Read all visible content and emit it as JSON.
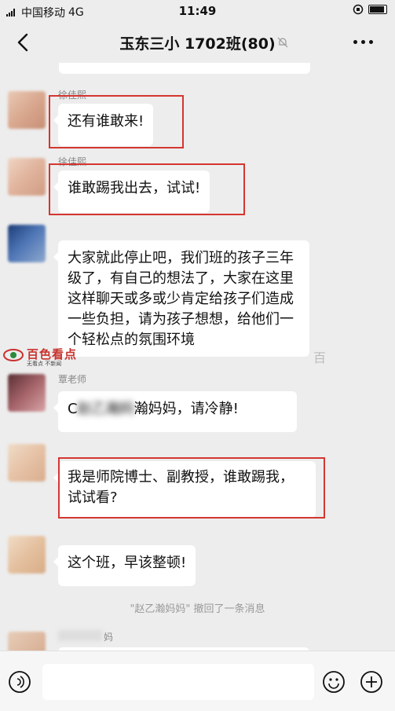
{
  "status_bar": {
    "carrier": "中国移动",
    "network": "4G",
    "time": "11:49"
  },
  "nav": {
    "title": "玉东三小 1702班(80)"
  },
  "messages": [
    {
      "sender": "徐佳熙",
      "text": "还有谁敢来!"
    },
    {
      "sender": "徐佳熙",
      "text": "谁敢踢我出去，试试!"
    },
    {
      "sender": "",
      "text": "大家就此停止吧，我们班的孩子三年级了，有自己的想法了，大家在这里这样聊天或多或少肯定给孩子们造成一些负担，请为孩子想想，给他们一个轻松点的氛围环境"
    },
    {
      "sender": "覃老师",
      "text_visible": "C",
      "text_hidden": "赵乙瀚妈",
      "text_end": "瀚妈妈，请冷静!"
    },
    {
      "sender": "",
      "text": "我是师院博士、副教授，谁敢踢我，试试看?"
    },
    {
      "sender": "",
      "text": "这个班，早该整顿!"
    },
    {
      "sender": "妈",
      "text": ""
    }
  ],
  "recall_notice": "\"赵乙瀚妈妈\" 撤回了一条消息",
  "watermark": {
    "title": "百色看点",
    "subtitle": "无看点 不新闻",
    "right_char": "百"
  },
  "colors": {
    "background": "#ededed",
    "highlight": "#d43630",
    "bubble": "#ffffff"
  },
  "icons": [
    "back-icon",
    "mute-icon",
    "more-icon",
    "voice-icon",
    "emoji-icon",
    "plus-icon"
  ]
}
